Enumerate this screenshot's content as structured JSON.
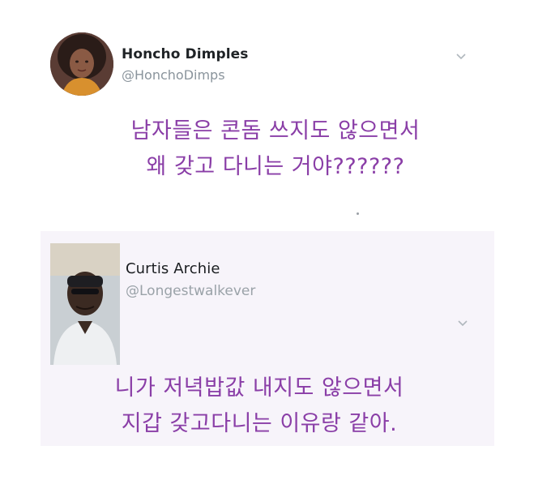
{
  "tweets": [
    {
      "display_name": "Honcho Dimples",
      "handle": "@HonchoDimps",
      "text_line_1": "남자들은 콘돔 쓰지도 않으면서",
      "text_line_2": "왜 갖고 다니는 거야??????",
      "avatar": "woman-portrait-avatar",
      "menu_icon": "chevron-down-icon"
    },
    {
      "display_name": "Curtis Archie",
      "handle": "@Longestwalkever",
      "text_line_1": "니가 저녁밥값 내지도 않으면서",
      "text_line_2": "지갑 갖고다니는 이유랑 같아.",
      "avatar": "man-portrait-avatar",
      "menu_icon": "chevron-down-icon"
    }
  ],
  "colors": {
    "tweet_text": "#8a3ea7",
    "display_name": "#1f2326",
    "handle": "#8a949c",
    "background": "#ffffff"
  }
}
